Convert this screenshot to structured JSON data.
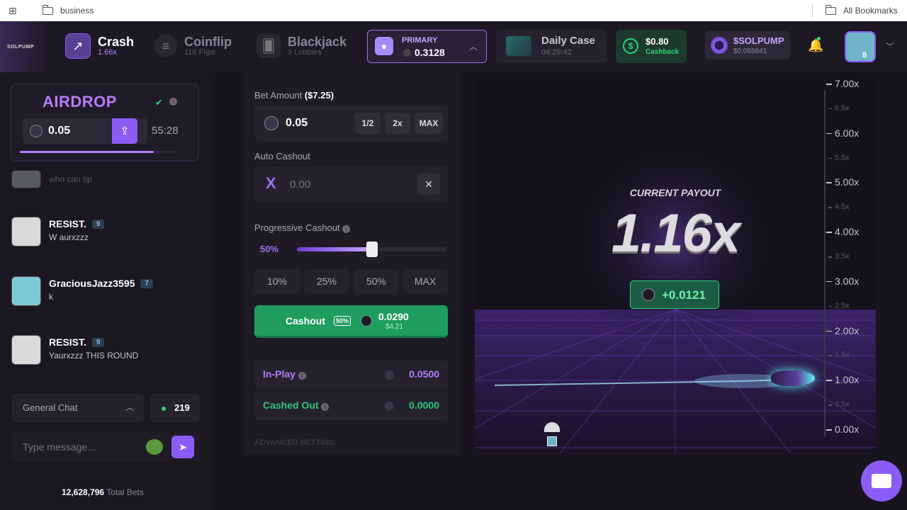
{
  "bookmarks": {
    "folder": "business",
    "all": "All Bookmarks"
  },
  "brand": {
    "logo": "SOLPUMP"
  },
  "nav": {
    "crash": {
      "title": "Crash",
      "sub": "1.66x"
    },
    "coinflip": {
      "title": "Coinflip",
      "sub": "116 Flips"
    },
    "blackjack": {
      "title": "Blackjack",
      "sub": "9 Lobbies"
    },
    "primary": {
      "label": "PRIMARY",
      "balance": "0.3128"
    },
    "daily_case": {
      "title": "Daily Case",
      "timer": "04:29:42"
    },
    "cashback": {
      "amount": "$0.80",
      "label": "Cashback"
    },
    "solpump": {
      "title": "$SOLPUMP",
      "value": "$0.088841"
    },
    "avatar_badge": "8"
  },
  "airdrop": {
    "title": "AIRDROP",
    "amount": "0.05",
    "timer": "55:28",
    "progress": 0.85
  },
  "chat": {
    "faded_text": "who can tip",
    "messages": [
      {
        "name": "RESIST.",
        "level": "9",
        "text": "W aurxzzz"
      },
      {
        "name": "GraciousJazz3595",
        "level": "7",
        "text": "k"
      },
      {
        "name": "RESIST.",
        "level": "9",
        "text": "Yaurxzzz THIS ROUND"
      }
    ],
    "channel": "General Chat",
    "online": "219",
    "placeholder": "Type message...",
    "total_bets": "12,628,796",
    "total_bets_label": "Total Bets"
  },
  "bet": {
    "label": "Bet Amount",
    "usd": "($7.25)",
    "amount": "0.05",
    "half": "1/2",
    "double": "2x",
    "max": "MAX",
    "auto_label": "Auto Cashout",
    "auto_value": "0.00",
    "prog_label": "Progressive Cashout",
    "prog_pct": "50%",
    "prog_value": 0.5,
    "pcts": [
      "10%",
      "25%",
      "50%",
      "MAX"
    ],
    "cashout_label": "Cashout",
    "cashout_badge": "50%",
    "cashout_amount": "0.0290",
    "cashout_usd": "$4.21",
    "inplay_label": "In-Play",
    "inplay_value": "0.0500",
    "cashed_label": "Cashed Out",
    "cashed_value": "0.0000",
    "advanced": "ADVANCED BETTING"
  },
  "game": {
    "payout_label": "CURRENT PAYOUT",
    "payout": "1.16x",
    "gain": "+0.0121",
    "ticks": [
      {
        "l": "7.00x",
        "major": true
      },
      {
        "l": "6.5x",
        "major": false
      },
      {
        "l": "6.00x",
        "major": true
      },
      {
        "l": "5.5x",
        "major": false
      },
      {
        "l": "5.00x",
        "major": true
      },
      {
        "l": "4.5x",
        "major": false
      },
      {
        "l": "4.00x",
        "major": true
      },
      {
        "l": "3.5x",
        "major": false
      },
      {
        "l": "3.00x",
        "major": true
      },
      {
        "l": "2.5x",
        "major": false
      },
      {
        "l": "2.00x",
        "major": true
      },
      {
        "l": "1.5x",
        "major": false
      },
      {
        "l": "1.00x",
        "major": true
      },
      {
        "l": "0.5x",
        "major": false
      },
      {
        "l": "0.00x",
        "major": true
      }
    ]
  },
  "colors": {
    "accent": "#8b5cf6",
    "green": "#22a565",
    "dark": "#1e1b25"
  }
}
